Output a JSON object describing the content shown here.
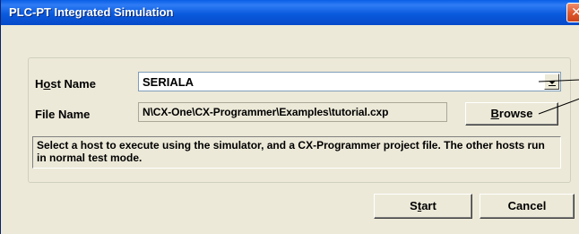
{
  "window": {
    "title": "PLC-PT Integrated Simulation",
    "close_glyph": "✕"
  },
  "form": {
    "host_label_pre": "H",
    "host_label_ul": "o",
    "host_label_post": "st Name",
    "host_value": "SERIALA",
    "file_label": "File Name",
    "file_value": "N\\CX-One\\CX-Programmer\\Examples\\tutorial.cxp",
    "browse_pre": "",
    "browse_ul": "B",
    "browse_post": "rowse",
    "description": "Select a host to execute using the simulator, and a CX-Programmer project file. The other hosts run in normal test mode."
  },
  "buttons": {
    "start_pre": "S",
    "start_ul": "t",
    "start_post": "art",
    "cancel": "Cancel"
  },
  "colors": {
    "titlebar": "#0b5bde",
    "dialog_bg": "#ece9d8",
    "close_button": "#e05a2e"
  }
}
